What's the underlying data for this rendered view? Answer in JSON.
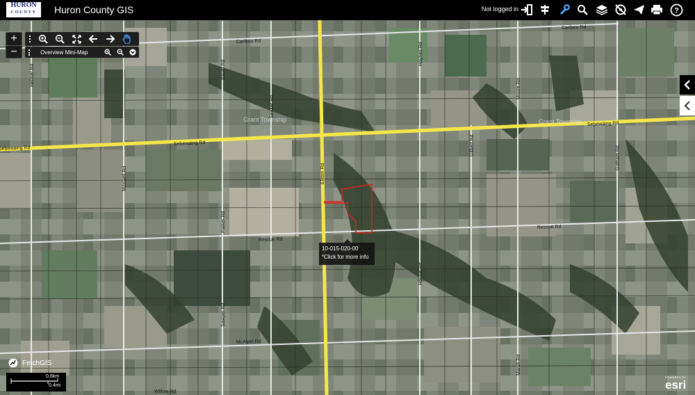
{
  "header": {
    "logo_line1": "HURON",
    "logo_line2": "COUNTY",
    "title": "Huron County GIS",
    "login_status": "Not logged in",
    "icons": [
      "login-icon",
      "signpost-icon",
      "wrench-icon",
      "search-icon",
      "layers-icon",
      "identify-icon",
      "send-icon",
      "print-icon",
      "help-icon"
    ]
  },
  "map": {
    "roads": [
      "Caribou Rd",
      "Caribou Rd",
      "Sebewaing Rd",
      "Sebewaing Rd",
      "Sebewaing Rd",
      "Rescue Rd",
      "Rescue Rd",
      "McAlpin Rd",
      "Elkton Rd",
      "Maxwell Rd",
      "Sawyer Rd",
      "Parker Rd",
      "Bauer Rd",
      "Seeker Rd",
      "Haynes Rd",
      "Moore Rd",
      "Gilbert Rd",
      "Hansel Rd",
      "Helmer Rd",
      "Willow Rd",
      "Gotham Rd",
      "Marsh Rd"
    ],
    "area_labels": [
      "Grant Township",
      "Grant Township"
    ],
    "parcel_tooltip": {
      "parcel_id": "10-015-020-00",
      "hint": "*Click for more info"
    },
    "highlight_color": "#e0201c",
    "highway_color": "#f5e74a"
  },
  "zoom": {
    "plus": "+",
    "minus": "−"
  },
  "toolbar": {
    "tools": [
      "zoom-in-icon",
      "zoom-out-icon",
      "full-extent-icon",
      "back-arrow-icon",
      "forward-arrow-icon",
      "pan-hand-icon"
    ]
  },
  "minimap": {
    "label": "Overview Mini-Map"
  },
  "branding": {
    "fetch": "FetchGIS",
    "powered_by": "POWERED BY",
    "esri": "esri"
  },
  "scale": {
    "km": "0.6km",
    "mi": "0.4mi"
  }
}
